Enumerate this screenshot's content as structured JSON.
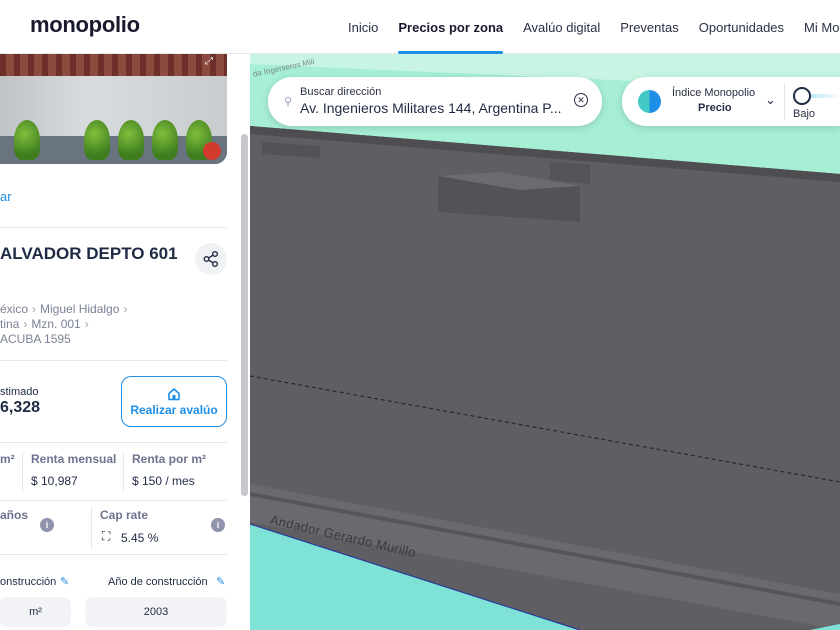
{
  "header": {
    "logo": "monopolio",
    "nav": [
      {
        "label": "Inicio",
        "active": false
      },
      {
        "label": "Precios por zona",
        "active": true
      },
      {
        "label": "Avalúo digital",
        "active": false
      },
      {
        "label": "Preventas",
        "active": false
      },
      {
        "label": "Oportunidades",
        "active": false
      },
      {
        "label": "Mi Mono",
        "active": false
      }
    ]
  },
  "panel": {
    "photo_expand_icon": "expand-icon",
    "link_text": "ar",
    "address_title": "ALVADOR DEPTO 601",
    "share_icon": "share-icon",
    "breadcrumbs": {
      "line1": [
        "éxico",
        "Miguel Hidalgo"
      ],
      "line2": [
        "tina",
        "Mzn. 001"
      ],
      "line3": "ACUBA 1595"
    },
    "estimate": {
      "label": "stimado",
      "value": "6,328"
    },
    "avaluo_button": {
      "label": "Realizar avalúo",
      "icon": "house-icon"
    },
    "stats": {
      "col1_label": "m²",
      "renta_mensual_label": "Renta mensual",
      "renta_mensual_value": "$ 10,987",
      "renta_m2_label": "Renta por m²",
      "renta_m2_value": "$ 150 / mes"
    },
    "anos_label": "años",
    "cap_rate": {
      "label": "Cap rate",
      "value": "5.45 %",
      "icon": "scan-icon"
    },
    "info_icon_text": "i",
    "construction": {
      "left_label": "onstrucción",
      "right_label": "Año de construcción",
      "left_value": "m²",
      "right_value": "2003",
      "edit_icon": "edit-icon"
    }
  },
  "map": {
    "search": {
      "label": "Buscar dirección",
      "value": "Av. Ingenieros Militares 144, Argentina P...",
      "search_icon": "search-icon",
      "clear_icon": "clear-icon"
    },
    "index": {
      "title": "Índice Monopolio",
      "subtitle": "Precio",
      "level_label": "Bajo"
    },
    "street_labels": [
      "Andador Gerardo Murillo",
      "da Ingenieros Mili"
    ],
    "colors": {
      "lot": "#5f5f63",
      "green": "#a6efd4",
      "teal": "#7ee3d6",
      "accent": "#1f8ee6"
    }
  }
}
